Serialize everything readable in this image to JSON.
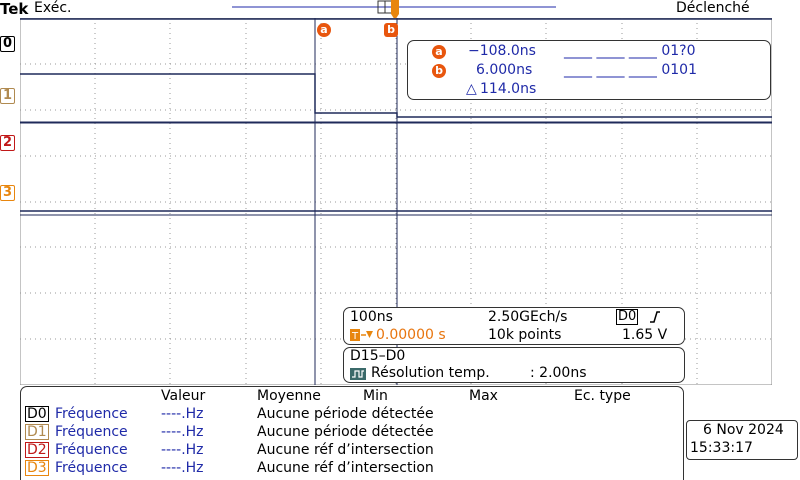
{
  "brand": "Tek",
  "status": "Exéc.",
  "trigger_state": "Déclenché",
  "channels": [
    {
      "label": "0",
      "color": "#000000"
    },
    {
      "label": "1",
      "color": "#b08a50"
    },
    {
      "label": "2",
      "color": "#c01818"
    },
    {
      "label": "3",
      "color": "#e8860e"
    }
  ],
  "cursors": {
    "a": {
      "tag": "a",
      "time": "−108.0ns",
      "pattern": "____ ____ ____ 01?0"
    },
    "b": {
      "tag": "b",
      "time": "6.000ns",
      "pattern": "____ ____ ____ 0101"
    },
    "delta": "114.0ns",
    "delta_symbol": "△"
  },
  "acquisition": {
    "timebase": "100ns",
    "sample_rate": "2.50GEch/s",
    "trigger_source": "D0",
    "trigger_slope_icon": "rising-edge-icon",
    "trigger_position": "0.00000 s",
    "record_length": "10k points",
    "trigger_level": "1.65 V"
  },
  "bus": {
    "name": "D15–D0",
    "resolution_label": "Résolution temp.",
    "resolution_value": ": 2.00ns"
  },
  "measurements": {
    "headers": {
      "value": "Valeur",
      "mean": "Moyenne",
      "min": "Min",
      "max": "Max",
      "std": "Ec. type"
    },
    "rows": [
      {
        "channel": "D0",
        "color": "#000000",
        "name": "Fréquence",
        "value": "----.Hz",
        "note": "Aucune période détectée"
      },
      {
        "channel": "D1",
        "color": "#b08a50",
        "name": "Fréquence",
        "value": "----.Hz",
        "note": "Aucune période détectée"
      },
      {
        "channel": "D2",
        "color": "#c01818",
        "name": "Fréquence",
        "value": "----.Hz",
        "note": "Aucune réf d’intersection"
      },
      {
        "channel": "D3",
        "color": "#e8860e",
        "name": "Fréquence",
        "value": "----.Hz",
        "note": "Aucune réf d’intersection"
      }
    ]
  },
  "datetime": {
    "date": "6 Nov 2024",
    "time": "15:33:17"
  }
}
